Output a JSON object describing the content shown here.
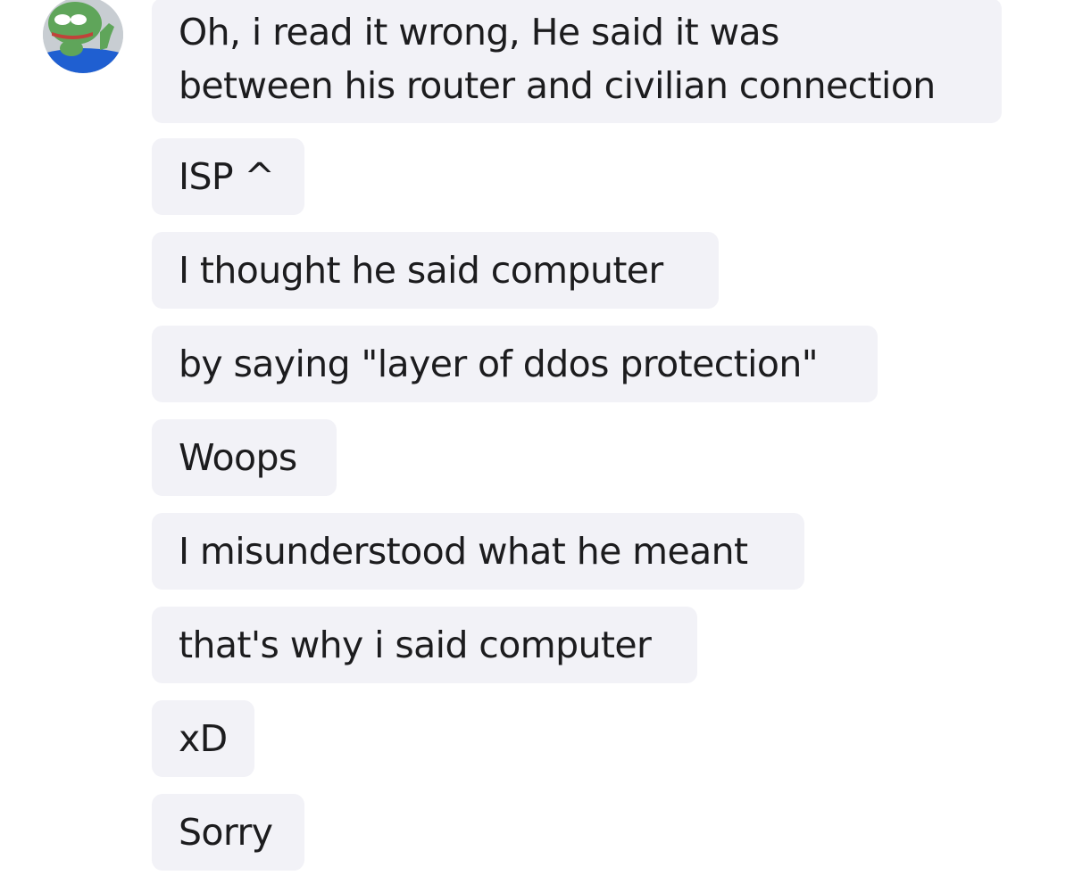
{
  "conversation": {
    "sender_avatar": {
      "icon": "pepe-frog-avatar-icon",
      "colors": {
        "background": "#c8cdd2",
        "frog": "#5fa55a",
        "shirt": "#1f5fd1"
      }
    },
    "bubble_color": "#f2f2f7",
    "text_color": "#1c1c1e",
    "messages": [
      {
        "text": "Oh, i read it wrong, He said it was\nbetween his router and civilian connection"
      },
      {
        "text": "ISP ^"
      },
      {
        "text": "I thought he said computer"
      },
      {
        "text": "by saying \"layer of ddos protection\""
      },
      {
        "text": "Woops"
      },
      {
        "text": "I misunderstood what he meant"
      },
      {
        "text": "that's why i said computer"
      },
      {
        "text": "xD"
      },
      {
        "text": "Sorry"
      }
    ]
  }
}
